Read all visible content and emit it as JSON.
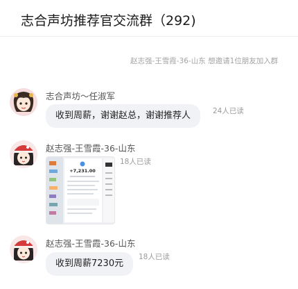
{
  "header": {
    "title": "志合声坊推荐官交流群（292)"
  },
  "system_message": "赵志强-王雪霞-36-山东 想邀请1位朋友加入群",
  "messages": [
    {
      "sender": "志合声坊～任淑军",
      "text": "收到周薪，谢谢赵总，谢谢推荐人",
      "read": "24人已读"
    },
    {
      "sender": "赵志强-王雪霞-36-山东",
      "image": "payment-screenshot",
      "read": "18人已读"
    },
    {
      "sender": "赵志强-王雪霞-36-山东",
      "text": "收到周薪7230元",
      "read": "18人已读"
    }
  ],
  "screenshot_amount": "+7,231.00"
}
